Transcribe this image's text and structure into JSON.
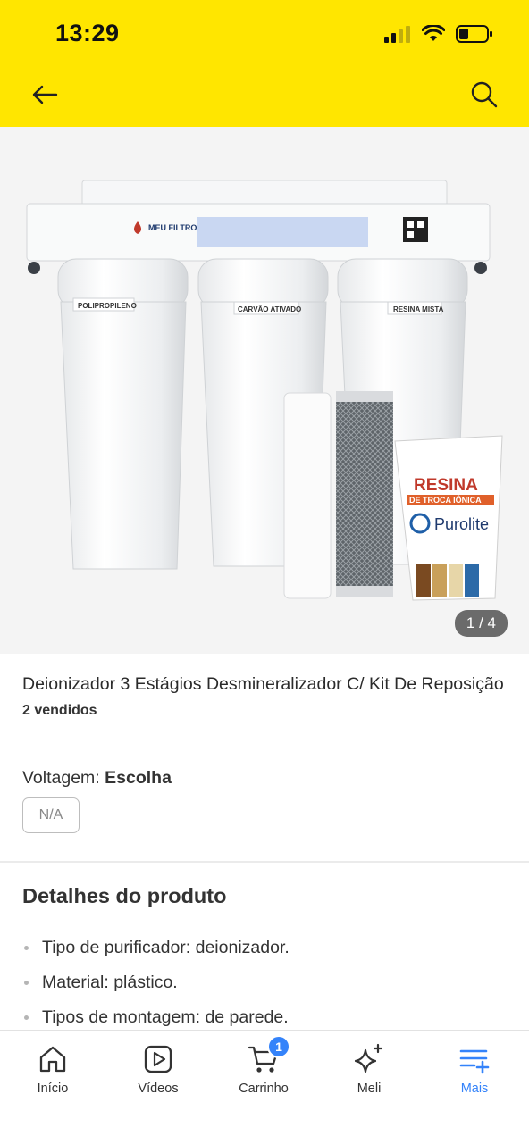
{
  "status_bar": {
    "time": "13:29"
  },
  "gallery": {
    "counter": "1 / 4",
    "labels": {
      "brand": "MEU FILTRO",
      "housing1": "POLIPROPILENO",
      "housing2": "CARVÃO ATIVADO",
      "housing3": "RESINA MISTA",
      "bag_line1": "RESINA",
      "bag_line2": "DE TROCA IÔNICA",
      "bag_brand": "Purolite"
    }
  },
  "product": {
    "title": "Deionizador 3 Estágios Desmineralizador C/ Kit De Reposição",
    "sold": "2 vendidos"
  },
  "variant": {
    "label": "Voltagem:",
    "value": "Escolha",
    "option": "N/A"
  },
  "details": {
    "title": "Detalhes do produto",
    "items": [
      "Tipo de purificador: deionizador.",
      "Material: plástico.",
      "Tipos de montagem: de parede."
    ]
  },
  "tabbar": {
    "items": [
      {
        "label": "Início",
        "icon": "home-icon"
      },
      {
        "label": "Vídeos",
        "icon": "video-play-icon"
      },
      {
        "label": "Carrinho",
        "icon": "cart-icon",
        "badge": "1"
      },
      {
        "label": "Meli",
        "icon": "sparkle-icon"
      },
      {
        "label": "Mais",
        "icon": "menu-plus-icon"
      }
    ],
    "active": "Mais",
    "active_color": "#3483fa"
  },
  "colors": {
    "header_bg": "#ffe600",
    "accent": "#3483fa"
  }
}
